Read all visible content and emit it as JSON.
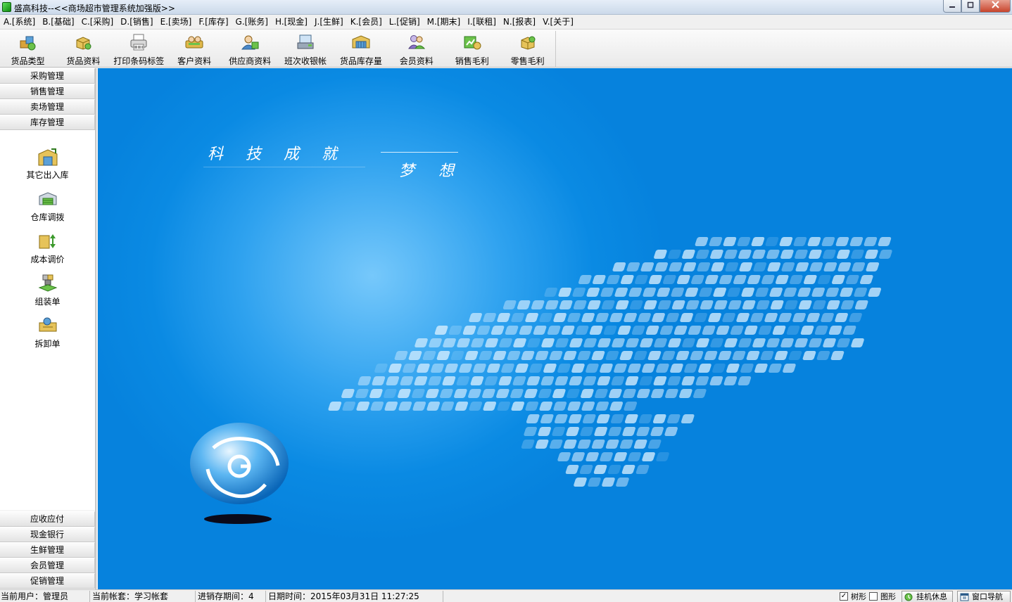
{
  "window": {
    "title": "盛高科技--<<商场超市管理系统加强版>>",
    "minimize_icon": "minimize-icon",
    "maximize_icon": "maximize-icon",
    "close_icon": "close-icon"
  },
  "menu": [
    {
      "label": "A.[系统]"
    },
    {
      "label": "B.[基础]"
    },
    {
      "label": "C.[采购]"
    },
    {
      "label": "D.[销售]"
    },
    {
      "label": "E.[卖场]"
    },
    {
      "label": "F.[库存]"
    },
    {
      "label": "G.[账务]"
    },
    {
      "label": "H.[现金]"
    },
    {
      "label": "J.[生鲜]"
    },
    {
      "label": "K.[会员]"
    },
    {
      "label": "L.[促销]"
    },
    {
      "label": "M.[期末]"
    },
    {
      "label": "I.[联租]"
    },
    {
      "label": "N.[报表]"
    },
    {
      "label": "V.[关于]"
    }
  ],
  "toolbar": [
    {
      "label": "货品类型",
      "icon": "goods-category-icon"
    },
    {
      "label": "货品资料",
      "icon": "goods-info-icon"
    },
    {
      "label": "打印条码标签",
      "icon": "barcode-printer-icon"
    },
    {
      "label": "客户资料",
      "icon": "customer-icon"
    },
    {
      "label": "供应商资料",
      "icon": "supplier-icon"
    },
    {
      "label": "班次收银帐",
      "icon": "cashier-shift-icon"
    },
    {
      "label": "货品库存量",
      "icon": "stock-level-icon"
    },
    {
      "label": "会员资料",
      "icon": "member-icon"
    },
    {
      "label": "销售毛利",
      "icon": "sales-profit-icon"
    },
    {
      "label": "零售毛利",
      "icon": "retail-profit-icon"
    }
  ],
  "sidebar": {
    "top_groups": [
      {
        "label": "采购管理"
      },
      {
        "label": "销售管理"
      },
      {
        "label": "卖场管理"
      },
      {
        "label": "库存管理"
      }
    ],
    "active_items": [
      {
        "label": "其它出入库",
        "icon": "other-inout-icon"
      },
      {
        "label": "仓库调拨",
        "icon": "warehouse-transfer-icon"
      },
      {
        "label": "成本调价",
        "icon": "cost-adjust-icon"
      },
      {
        "label": "组装单",
        "icon": "assembly-icon"
      },
      {
        "label": "拆卸单",
        "icon": "disassembly-icon"
      }
    ],
    "bottom_groups": [
      {
        "label": "应收应付"
      },
      {
        "label": "现金银行"
      },
      {
        "label": "生鲜管理"
      },
      {
        "label": "会员管理"
      },
      {
        "label": "促销管理"
      }
    ]
  },
  "banner": {
    "slogan_line1": "科技成就",
    "slogan_line2": "梦想",
    "logo_icon": "g-logo-icon",
    "colors": {
      "bg_dark": "#0682dd",
      "bg_light": "#76c8fb"
    }
  },
  "status": {
    "user": "当前用户：管理员",
    "account": "当前帐套：学习帐套",
    "period": "进销存期间：4",
    "datetime": "日期时间：2015年03月31日 11:27:25",
    "tree_label": "树形",
    "tree_checked": "✓",
    "graphic_label": "图形",
    "idle_label": "挂机休息",
    "nav_label": "窗口导航"
  }
}
